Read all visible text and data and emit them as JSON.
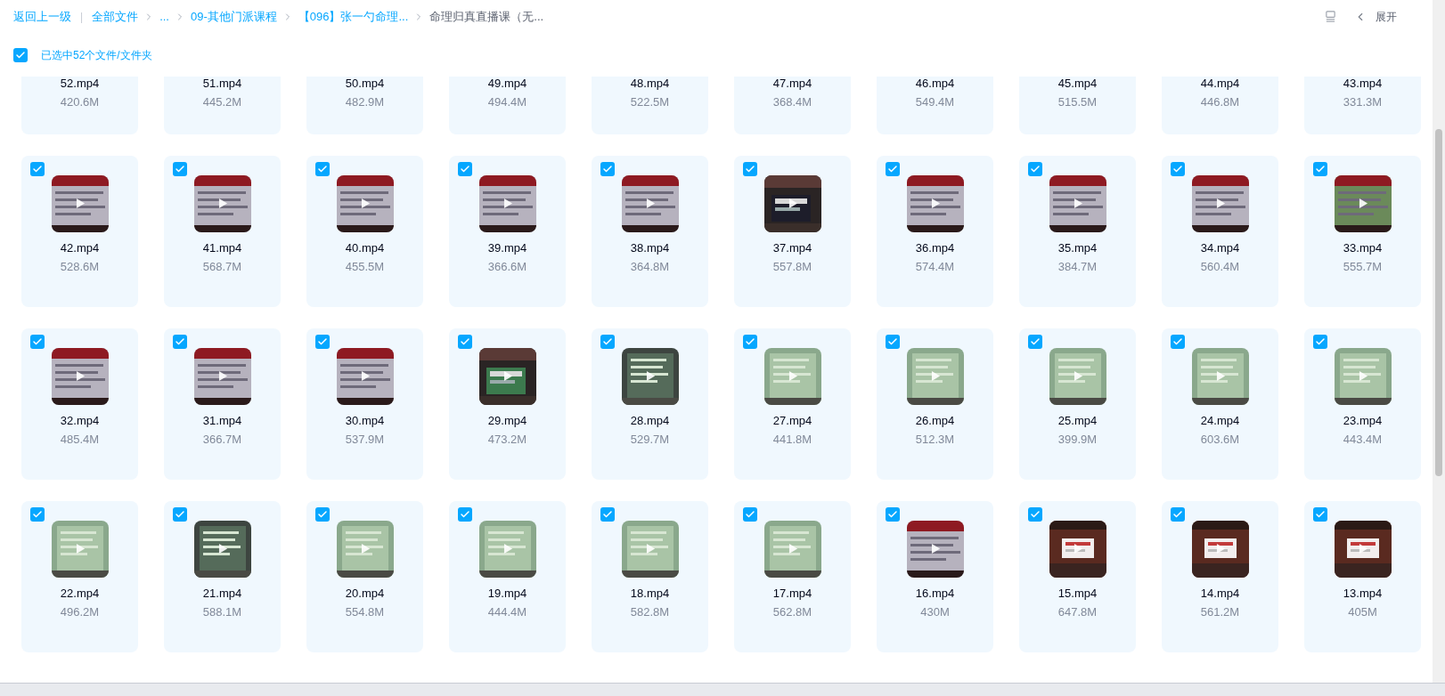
{
  "breadcrumb": {
    "back": "返回上一级",
    "divider": "|",
    "items": [
      {
        "label": "全部文件",
        "current": false
      },
      {
        "label": "...",
        "current": false
      },
      {
        "label": "09-其他门派课程",
        "current": false
      },
      {
        "label": "【096】张一勺命理...",
        "current": false
      },
      {
        "label": "命理归真直播课（无...",
        "current": true
      }
    ]
  },
  "toolbar": {
    "expand": "展开"
  },
  "selection": {
    "checked": true,
    "label": "已选中52个文件/文件夹"
  },
  "file_rows": [
    {
      "files": [
        {
          "name": "52.mp4",
          "size": "420.6M"
        },
        {
          "name": "51.mp4",
          "size": "445.2M"
        },
        {
          "name": "50.mp4",
          "size": "482.9M"
        },
        {
          "name": "49.mp4",
          "size": "494.4M"
        },
        {
          "name": "48.mp4",
          "size": "522.5M"
        },
        {
          "name": "47.mp4",
          "size": "368.4M"
        },
        {
          "name": "46.mp4",
          "size": "549.4M"
        },
        {
          "name": "45.mp4",
          "size": "515.5M"
        },
        {
          "name": "44.mp4",
          "size": "446.8M"
        },
        {
          "name": "43.mp4",
          "size": "331.3M"
        }
      ]
    },
    {
      "files": [
        {
          "name": "42.mp4",
          "size": "528.6M",
          "checked": true
        },
        {
          "name": "41.mp4",
          "size": "568.7M",
          "checked": true
        },
        {
          "name": "40.mp4",
          "size": "455.5M",
          "checked": true
        },
        {
          "name": "39.mp4",
          "size": "366.6M",
          "checked": true
        },
        {
          "name": "38.mp4",
          "size": "364.8M",
          "checked": true
        },
        {
          "name": "37.mp4",
          "size": "557.8M",
          "checked": true
        },
        {
          "name": "36.mp4",
          "size": "574.4M",
          "checked": true
        },
        {
          "name": "35.mp4",
          "size": "384.7M",
          "checked": true
        },
        {
          "name": "34.mp4",
          "size": "560.4M",
          "checked": true
        },
        {
          "name": "33.mp4",
          "size": "555.7M",
          "checked": true
        }
      ]
    },
    {
      "files": [
        {
          "name": "32.mp4",
          "size": "485.4M",
          "checked": true
        },
        {
          "name": "31.mp4",
          "size": "366.7M",
          "checked": true
        },
        {
          "name": "30.mp4",
          "size": "537.9M",
          "checked": true
        },
        {
          "name": "29.mp4",
          "size": "473.2M",
          "checked": true
        },
        {
          "name": "28.mp4",
          "size": "529.7M",
          "checked": true
        },
        {
          "name": "27.mp4",
          "size": "441.8M",
          "checked": true
        },
        {
          "name": "26.mp4",
          "size": "512.3M",
          "checked": true
        },
        {
          "name": "25.mp4",
          "size": "399.9M",
          "checked": true
        },
        {
          "name": "24.mp4",
          "size": "603.6M",
          "checked": true
        },
        {
          "name": "23.mp4",
          "size": "443.4M",
          "checked": true
        }
      ]
    },
    {
      "files": [
        {
          "name": "22.mp4",
          "size": "496.2M",
          "checked": true
        },
        {
          "name": "21.mp4",
          "size": "588.1M",
          "checked": true
        },
        {
          "name": "20.mp4",
          "size": "554.8M",
          "checked": true
        },
        {
          "name": "19.mp4",
          "size": "444.4M",
          "checked": true
        },
        {
          "name": "18.mp4",
          "size": "582.8M",
          "checked": true
        },
        {
          "name": "17.mp4",
          "size": "562.8M",
          "checked": true
        },
        {
          "name": "16.mp4",
          "size": "430M",
          "checked": true
        },
        {
          "name": "15.mp4",
          "size": "647.8M",
          "checked": true
        },
        {
          "name": "14.mp4",
          "size": "561.2M",
          "checked": true
        },
        {
          "name": "13.mp4",
          "size": "405M",
          "checked": true
        }
      ]
    }
  ]
}
